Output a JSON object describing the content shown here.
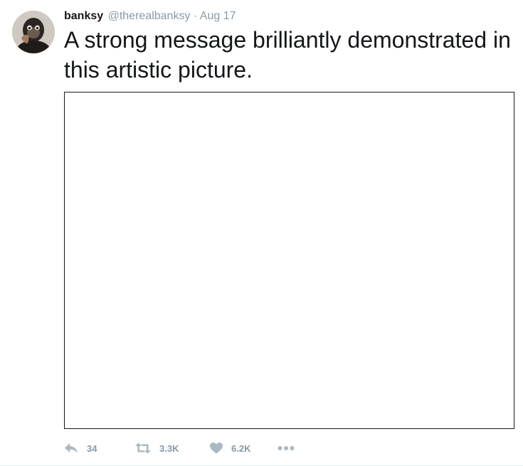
{
  "tweet": {
    "author": {
      "display_name": "banksy",
      "handle": "@therealbanksy"
    },
    "separator": "·",
    "timestamp": "Aug 17",
    "text": "A strong message brilliantly demonstrated in this artistic picture.",
    "actions": {
      "reply": {
        "icon": "reply-icon",
        "count": "34"
      },
      "retweet": {
        "icon": "retweet-icon",
        "count": "3.3K"
      },
      "like": {
        "icon": "heart-icon",
        "count": "6.2K"
      },
      "more": {
        "icon": "more-dots-icon"
      }
    },
    "colors": {
      "text": "#14171a",
      "secondary": "#8899a6",
      "icon": "#aab8c2"
    }
  }
}
